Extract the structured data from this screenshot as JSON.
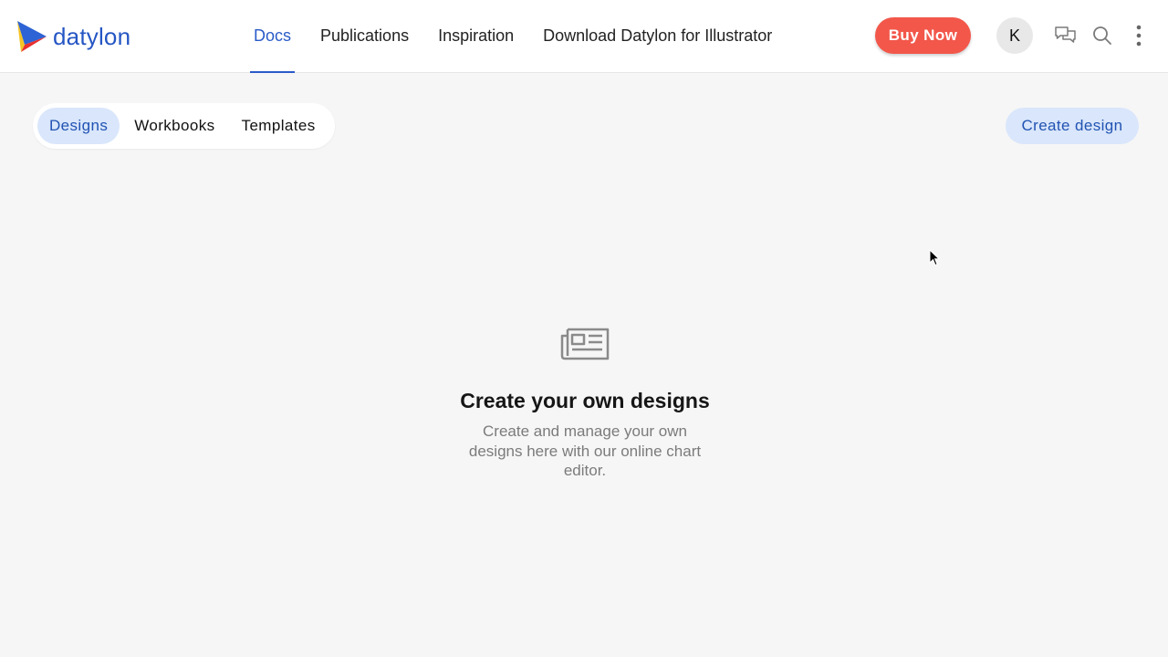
{
  "brand": {
    "name": "datylon"
  },
  "nav": {
    "items": [
      {
        "label": "Docs",
        "active": true
      },
      {
        "label": "Publications",
        "active": false
      },
      {
        "label": "Inspiration",
        "active": false
      },
      {
        "label": "Download Datylon for Illustrator",
        "active": false
      }
    ]
  },
  "header": {
    "buy_label": "Buy Now",
    "avatar_initial": "K",
    "icons": [
      "chat-bubbles-icon",
      "search-icon",
      "more-vertical-icon"
    ],
    "buy_color": "#f2574a"
  },
  "tabs": [
    {
      "label": "Designs",
      "active": true
    },
    {
      "label": "Workbooks",
      "active": false
    },
    {
      "label": "Templates",
      "active": false
    }
  ],
  "actions": {
    "create_label": "Create design"
  },
  "empty_state": {
    "icon": "newspaper-icon",
    "title": "Create your own designs",
    "description": "Create and manage your own designs here with our online chart editor."
  },
  "colors": {
    "accent": "#2a5bc8",
    "accent_soft": "#d9e6fb",
    "background": "#f6f6f6"
  }
}
